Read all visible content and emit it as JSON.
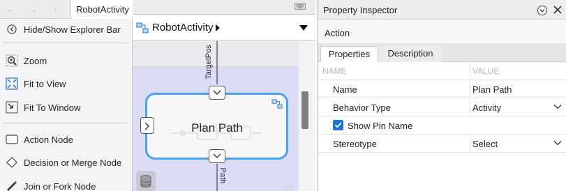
{
  "nav": {
    "back_icon": "back-arrow-icon",
    "forward_icon": "forward-arrow-icon",
    "up_icon": "up-arrow-icon",
    "tab_label": "RobotActivity"
  },
  "menu": {
    "items": [
      {
        "label": "Hide/Show Explorer Bar",
        "icon": "explorer-bar-icon"
      },
      {
        "label": "Zoom",
        "icon": "zoom-icon"
      },
      {
        "label": "Fit to View",
        "icon": "fit-to-view-icon"
      },
      {
        "label": "Fit To Window",
        "icon": "fit-to-window-icon"
      },
      {
        "label": "Action Node",
        "icon": "action-node-icon"
      },
      {
        "label": "Decision or Merge Node",
        "icon": "decision-node-icon"
      },
      {
        "label": "Join or Fork Node",
        "icon": "join-fork-node-icon"
      }
    ]
  },
  "canvas": {
    "breadcrumb": "RobotActivity",
    "node_title": "Plan Path",
    "input_pin_label": "TargetPos",
    "output_pin_label": "Path"
  },
  "inspector": {
    "title": "Property Inspector",
    "section": "Action",
    "tabs": [
      "Properties",
      "Description"
    ],
    "active_tab": "Properties",
    "columns": {
      "name": "NAME",
      "value": "VALUE"
    },
    "rows": [
      {
        "name": "Name",
        "value": "Plan Path"
      },
      {
        "name": "Behavior Type",
        "value": "Activity"
      },
      {
        "name": "Show Pin Name",
        "checked": true
      },
      {
        "name": "Stereotype",
        "value": "Select"
      }
    ]
  },
  "colors": {
    "selection_border": "#4aa3f0",
    "diagram_background": "#dcdcf7",
    "checkbox_fill": "#1f6fd6"
  }
}
